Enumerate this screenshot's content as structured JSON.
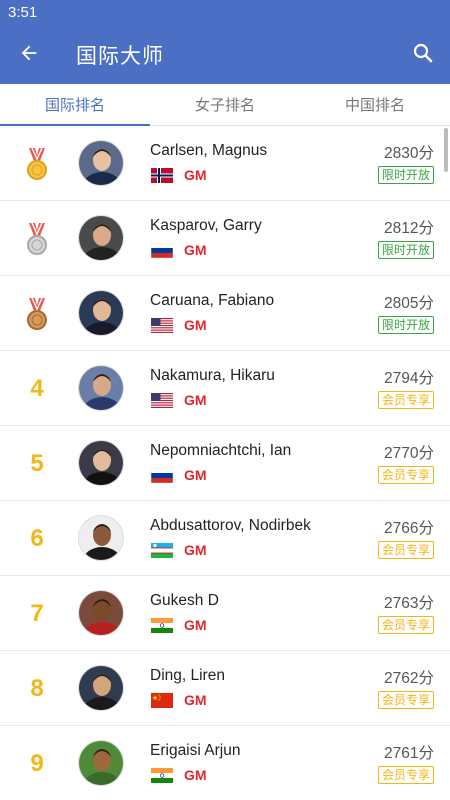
{
  "status_bar": {
    "time": "3:51"
  },
  "header": {
    "title": "国际大师",
    "back_icon": "arrow-left-icon",
    "search_icon": "search-icon"
  },
  "tabs": [
    {
      "label": "国际排名",
      "active": true
    },
    {
      "label": "女子排名",
      "active": false
    },
    {
      "label": "中国排名",
      "active": false
    }
  ],
  "colors": {
    "primary": "#4a6fc4",
    "gold": "#f2b616",
    "title_red": "#e0272d",
    "badge_green": "#3aa545"
  },
  "players": [
    {
      "rank": "1",
      "medal": "gold",
      "name": "Carlsen, Magnus",
      "country": "Norway",
      "title": "GM",
      "rating": "2830分",
      "badge": "限时开放",
      "badge_type": "green"
    },
    {
      "rank": "2",
      "medal": "silver",
      "name": "Kasparov, Garry",
      "country": "Russia",
      "title": "GM",
      "rating": "2812分",
      "badge": "限时开放",
      "badge_type": "green"
    },
    {
      "rank": "3",
      "medal": "bronze",
      "name": "Caruana, Fabiano",
      "country": "USA",
      "title": "GM",
      "rating": "2805分",
      "badge": "限时开放",
      "badge_type": "green"
    },
    {
      "rank": "4",
      "medal": "",
      "name": "Nakamura, Hikaru",
      "country": "USA",
      "title": "GM",
      "rating": "2794分",
      "badge": "会员专享",
      "badge_type": "gold"
    },
    {
      "rank": "5",
      "medal": "",
      "name": "Nepomniachtchi, Ian",
      "country": "Russia",
      "title": "GM",
      "rating": "2770分",
      "badge": "会员专享",
      "badge_type": "gold"
    },
    {
      "rank": "6",
      "medal": "",
      "name": "Abdusattorov, Nodirbek",
      "country": "Uzbekistan",
      "title": "GM",
      "rating": "2766分",
      "badge": "会员专享",
      "badge_type": "gold"
    },
    {
      "rank": "7",
      "medal": "",
      "name": "Gukesh D",
      "country": "India",
      "title": "GM",
      "rating": "2763分",
      "badge": "会员专享",
      "badge_type": "gold"
    },
    {
      "rank": "8",
      "medal": "",
      "name": "Ding, Liren",
      "country": "China",
      "title": "GM",
      "rating": "2762分",
      "badge": "会员专享",
      "badge_type": "gold"
    },
    {
      "rank": "9",
      "medal": "",
      "name": "Erigaisi Arjun",
      "country": "India",
      "title": "GM",
      "rating": "2761分",
      "badge": "会员专享",
      "badge_type": "gold"
    }
  ]
}
